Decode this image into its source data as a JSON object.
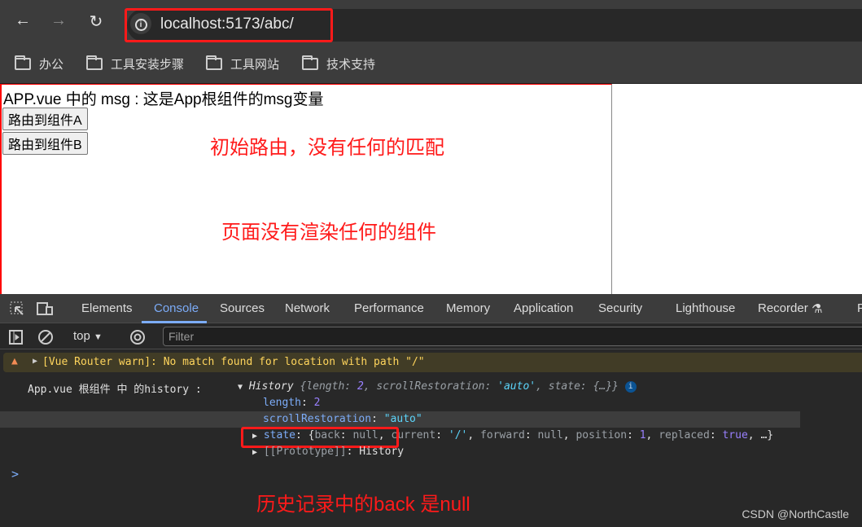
{
  "browser": {
    "url": "localhost:5173/abc/",
    "bookmarks": [
      "办公",
      "工具安装步骤",
      "工具网站",
      "技术支持"
    ]
  },
  "page": {
    "msg": "APP.vue 中的 msg : 这是App根组件的msg变量",
    "buttons": [
      "路由到组件A",
      "路由到组件B"
    ],
    "note1": "初始路由，没有任何的匹配",
    "note2": "页面没有渲染任何的组件"
  },
  "devtools": {
    "tabs": [
      "Elements",
      "Console",
      "Sources",
      "Network",
      "Performance",
      "Memory",
      "Application",
      "Security",
      "Lighthouse",
      "Recorder",
      "P"
    ],
    "active_tab": "Console",
    "context": "top",
    "filter_placeholder": "Filter"
  },
  "console": {
    "warning": "[Vue Router warn]: No match found for location with path \"/\"",
    "log_label": "App.vue 根组件 中 的history :",
    "history_summary": {
      "name": "History",
      "open": "{",
      "k1": "length",
      "v1": "2",
      "k2": "scrollRestoration",
      "v2": "'auto'",
      "k3": "state",
      "v3": "{…}",
      "close": "}"
    },
    "props": {
      "length_key": "length",
      "length_val": "2",
      "sr_key": "scrollRestoration",
      "sr_val": "\"auto\"",
      "state_key": "state",
      "state_val": {
        "back": "null",
        "current": "'/'",
        "forward": "null",
        "position": "1",
        "replaced": "true"
      },
      "proto_key": "[[Prototype]]",
      "proto_val": "History"
    },
    "prompt": ">"
  },
  "annotation": "历史记录中的back 是null",
  "watermark": "CSDN @NorthCastle",
  "colors": {
    "annotation": "#ff1a1a",
    "active_tab": "#7cacf8",
    "warning_bg": "#413c26"
  }
}
